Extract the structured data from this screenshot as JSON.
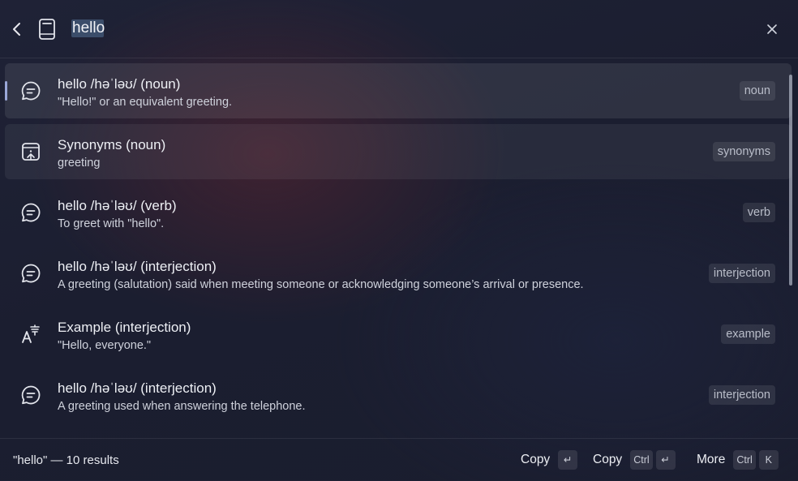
{
  "search": {
    "value": "hello",
    "placeholder": ""
  },
  "results": [
    {
      "icon": "chat-bubble-icon",
      "title": "hello  /həˈləʊ/ (noun)",
      "subtitle": "\"Hello!\" or an equivalent greeting.",
      "tag": "noun"
    },
    {
      "icon": "synonyms-icon",
      "title": "Synonyms (noun)",
      "subtitle": "greeting",
      "tag": "synonyms"
    },
    {
      "icon": "chat-bubble-icon",
      "title": "hello  /həˈləʊ/ (verb)",
      "subtitle": "To greet with \"hello\".",
      "tag": "verb"
    },
    {
      "icon": "chat-bubble-icon",
      "title": "hello  /həˈləʊ/ (interjection)",
      "subtitle": "A greeting (salutation) said when meeting someone or acknowledging someone’s arrival or presence.",
      "tag": "interjection"
    },
    {
      "icon": "translate-icon",
      "title": "Example (interjection)",
      "subtitle": "\"Hello, everyone.\"",
      "tag": "example"
    },
    {
      "icon": "chat-bubble-icon",
      "title": "hello  /həˈləʊ/ (interjection)",
      "subtitle": "A greeting used when answering the telephone.",
      "tag": "interjection"
    }
  ],
  "footer": {
    "status": "\"hello\" — 10 results",
    "actions": [
      {
        "label": "Copy",
        "keys": [
          "↵"
        ]
      },
      {
        "label": "Copy",
        "keys": [
          "Ctrl",
          "↵"
        ]
      },
      {
        "label": "More",
        "keys": [
          "Ctrl",
          "K"
        ]
      }
    ]
  }
}
